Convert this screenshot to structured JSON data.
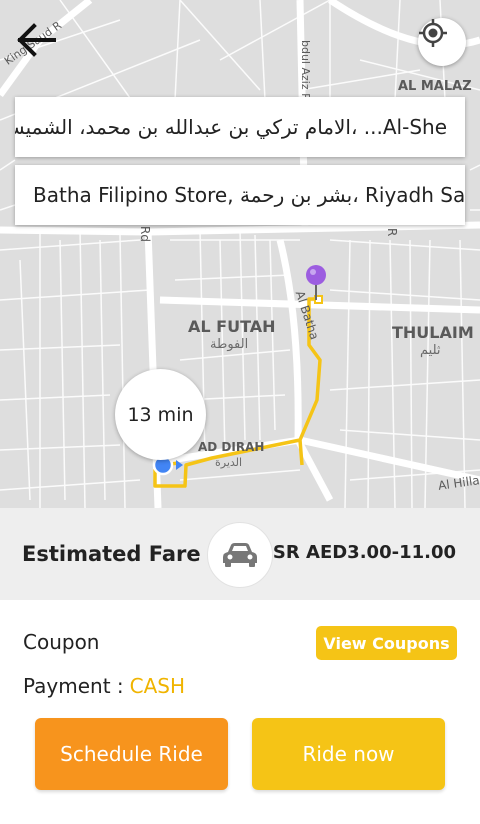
{
  "map": {
    "street_labels": {
      "king_saud": "King Saud R",
      "abdul_aziz": "bdul Aziz Rd",
      "al_batha": "Al Batha",
      "al_hilla": "Al Hilla",
      "rd_left": "Rd",
      "rd_right": "R"
    },
    "districts": {
      "al_malaz": "AL MALAZ",
      "al_futah": "AL FUTAH",
      "al_futah_ar": "الفوطة",
      "thulaim": "THULAIM",
      "thulaim_ar": "ثليم",
      "ad_dirah": "AD DIRAH",
      "ad_dirah_ar": "الديرة"
    },
    "colors": {
      "route": "#f5c416",
      "origin": "#4285f4",
      "destination": "#9c5de0"
    }
  },
  "trip": {
    "pickup_address": "الامام تركي بن عبدالله بن محمد، الشميسي، ...Al-She",
    "drop_address": "Batha Filipino Store, بشر بن رحمة، Riyadh Sa...",
    "eta": "13 min"
  },
  "fare": {
    "label": "Estimated Fare",
    "value": "SR AED3.00-11.00"
  },
  "coupon": {
    "label": "Coupon",
    "button_label": "View Coupons"
  },
  "payment": {
    "label": "Payment :",
    "value": "CASH"
  },
  "actions": {
    "schedule_label": "Schedule Ride",
    "ride_now_label": "Ride now"
  },
  "icons": {
    "back": "back-arrow-icon",
    "locate": "gps-crosshair-icon",
    "car": "car-icon",
    "pin": "location-pin-icon"
  },
  "theme": {
    "accent_yellow": "#f5c416",
    "accent_orange": "#f7941d"
  }
}
